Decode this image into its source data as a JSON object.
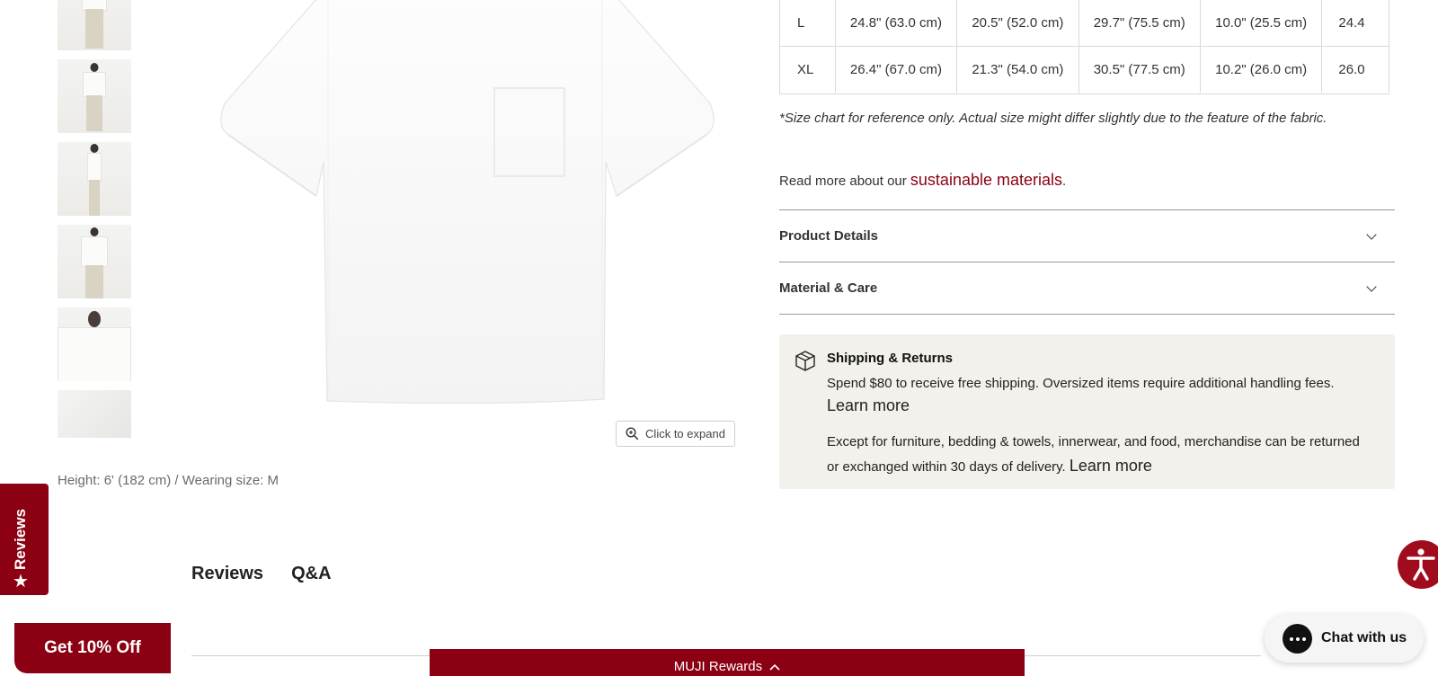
{
  "product": {
    "model_caption": "Height: 6' (182 cm) / Wearing size: M",
    "expand_label": "Click to expand",
    "thumbnails": [
      "full-front",
      "full-front-2",
      "side",
      "back",
      "detail-front",
      "fabric"
    ]
  },
  "size_table": {
    "rows": [
      {
        "size": "L",
        "cells": [
          "24.8\" (63.0 cm)",
          "20.5\" (52.0 cm)",
          "29.7\" (75.5 cm)",
          "10.0\" (25.5 cm)",
          "24.4"
        ]
      },
      {
        "size": "XL",
        "cells": [
          "26.4\" (67.0 cm)",
          "21.3\" (54.0 cm)",
          "30.5\" (77.5 cm)",
          "10.2\" (26.0 cm)",
          "26.0"
        ]
      }
    ],
    "note": "*Size chart for reference only. Actual size might differ slightly due to the feature of the fabric."
  },
  "read_more": {
    "prefix": "Read more about our ",
    "link": "sustainable materials",
    "suffix": "."
  },
  "accordions": [
    {
      "title": "Product Details"
    },
    {
      "title": "Material & Care"
    }
  ],
  "shipping": {
    "title": "Shipping & Returns",
    "text1": "Spend $80 to receive free shipping. Oversized items require additional handling fees.",
    "learn_more_1": "Learn more",
    "text2": "Except for furniture, bedding & towels, innerwear, and food, merchandise can be returned or exchanged within 30 days of delivery.",
    "learn_more_2": "Learn more"
  },
  "reviews_side_tab": "Reviews",
  "tabs": [
    "Reviews",
    "Q&A"
  ],
  "offer_button": "Get 10% Off",
  "rewards_bar": "MUJI Rewards",
  "chat_button": "Chat with us",
  "colors": {
    "accent": "#8b0012",
    "shipping_bg": "#f2f1ec"
  }
}
